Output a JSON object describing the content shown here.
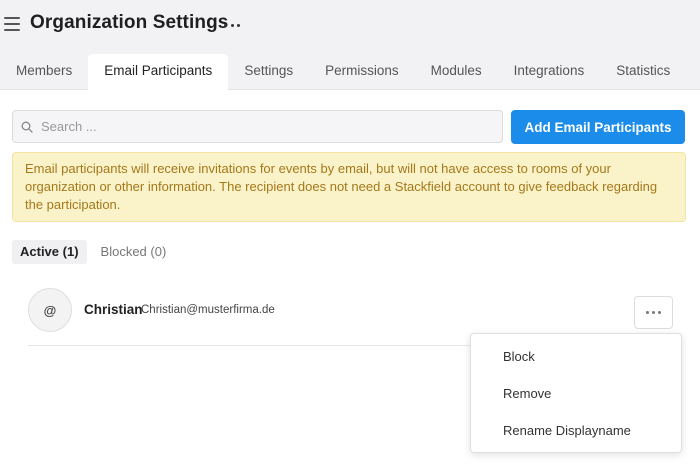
{
  "header": {
    "title": "Organization Settings",
    "tabs": [
      {
        "label": "Members",
        "active": false
      },
      {
        "label": "Email Participants",
        "active": true
      },
      {
        "label": "Settings",
        "active": false
      },
      {
        "label": "Permissions",
        "active": false
      },
      {
        "label": "Modules",
        "active": false
      },
      {
        "label": "Integrations",
        "active": false
      },
      {
        "label": "Statistics",
        "active": false
      }
    ]
  },
  "search": {
    "value": "",
    "placeholder": "Search ..."
  },
  "toolbar": {
    "add_label": "Add Email Participants",
    "accent": "#1b8cea"
  },
  "notice": {
    "text": "Email participants will receive invitations for events by email, but will not have access to rooms of your organization or other information. The recipient does not need a Stackfield account to give feedback regarding the participation."
  },
  "subtabs": [
    {
      "label": "Active (1)",
      "active": true
    },
    {
      "label": "Blocked (0)",
      "active": false
    }
  ],
  "participants": [
    {
      "avatar": "@",
      "name": "Christian",
      "email": "Christian@musterfirma.de"
    }
  ],
  "menu": {
    "items": [
      {
        "label": "Block"
      },
      {
        "label": "Remove"
      },
      {
        "label": "Rename Displayname"
      }
    ]
  },
  "icons": {
    "menu": "hamburger-icon",
    "more": "more-horizontal-icon",
    "search": "search-icon"
  }
}
